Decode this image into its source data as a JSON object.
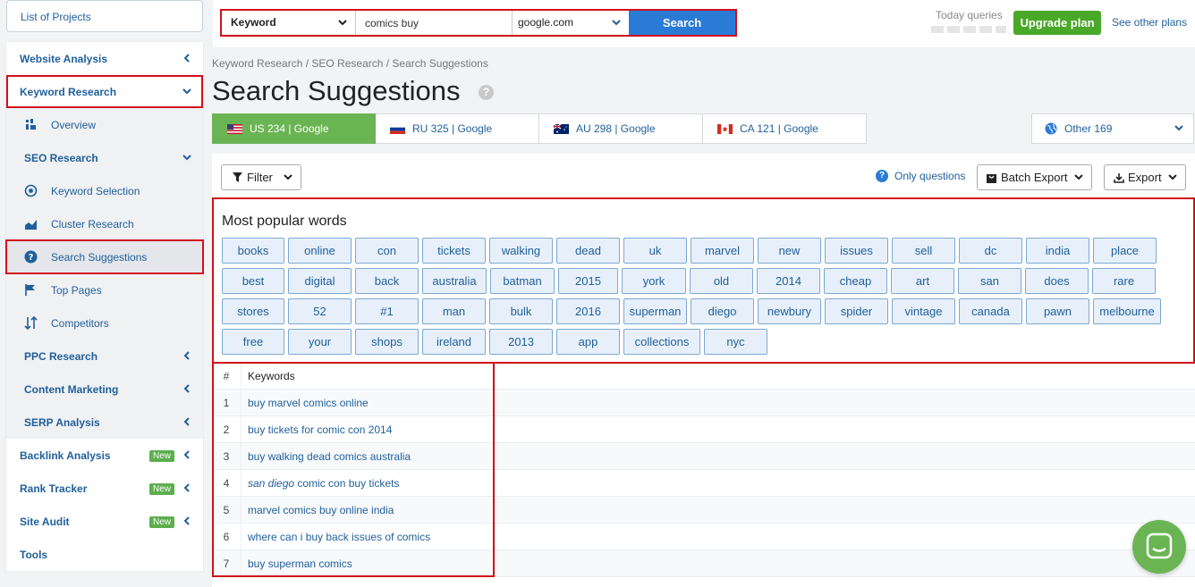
{
  "sidebar": {
    "projects_label": "List of Projects",
    "items": [
      {
        "label": "Website Analysis"
      },
      {
        "label": "Keyword Research"
      },
      {
        "label": "Overview"
      },
      {
        "label": "SEO Research"
      },
      {
        "label": "Keyword Selection"
      },
      {
        "label": "Cluster Research"
      },
      {
        "label": "Search Suggestions"
      },
      {
        "label": "Top Pages"
      },
      {
        "label": "Competitors"
      },
      {
        "label": "PPC Research"
      },
      {
        "label": "Content Marketing"
      },
      {
        "label": "SERP Analysis"
      },
      {
        "label": "Backlink Analysis",
        "badge": "New"
      },
      {
        "label": "Rank Tracker",
        "badge": "New"
      },
      {
        "label": "Site Audit",
        "badge": "New"
      },
      {
        "label": "Tools"
      }
    ]
  },
  "search": {
    "type_label": "Keyword",
    "query": "comics buy",
    "db": "google.com",
    "button": "Search"
  },
  "header": {
    "today_queries": "Today queries",
    "upgrade": "Upgrade plan",
    "other_plans": "See other plans"
  },
  "breadcrumb": "Keyword Research / SEO Research / Search Suggestions",
  "page_title": "Search Suggestions",
  "tabs": [
    {
      "label": "US 234 | Google"
    },
    {
      "label": "RU 325 | Google"
    },
    {
      "label": "AU 298 | Google"
    },
    {
      "label": "CA 121 | Google"
    }
  ],
  "other_tab": "Other 169",
  "toolbar": {
    "filter": "Filter",
    "only_questions": "Only questions",
    "batch_export": "Batch Export",
    "export": "Export"
  },
  "popular": {
    "title": "Most popular words",
    "rows": [
      [
        "books",
        "online",
        "con",
        "tickets",
        "walking",
        "dead",
        "uk",
        "marvel",
        "new",
        "issues",
        "sell",
        "dc",
        "india",
        "place"
      ],
      [
        "best",
        "digital",
        "back",
        "australia",
        "batman",
        "2015",
        "york",
        "old",
        "2014",
        "cheap",
        "art",
        "san",
        "does",
        "rare"
      ],
      [
        "stores",
        "52",
        "#1",
        "man",
        "bulk",
        "2016",
        "superman",
        "diego",
        "newbury",
        "spider",
        "vintage",
        "canada",
        "pawn",
        "melbourne"
      ],
      [
        "free",
        "your",
        "shops",
        "ireland",
        "2013",
        "app",
        "collections",
        "nyc"
      ]
    ]
  },
  "table": {
    "col_num": "#",
    "col_kw": "Keywords",
    "rows": [
      {
        "n": "1",
        "kw": "buy marvel comics online"
      },
      {
        "n": "2",
        "kw": "buy tickets for comic con 2014"
      },
      {
        "n": "3",
        "kw": "buy walking dead comics australia"
      },
      {
        "n": "4",
        "kw_italic": "san diego",
        "kw": " comic con buy tickets"
      },
      {
        "n": "5",
        "kw": "marvel comics buy online india"
      },
      {
        "n": "6",
        "kw": "where can i buy back issues of comics"
      },
      {
        "n": "7",
        "kw": "buy superman comics"
      }
    ]
  }
}
